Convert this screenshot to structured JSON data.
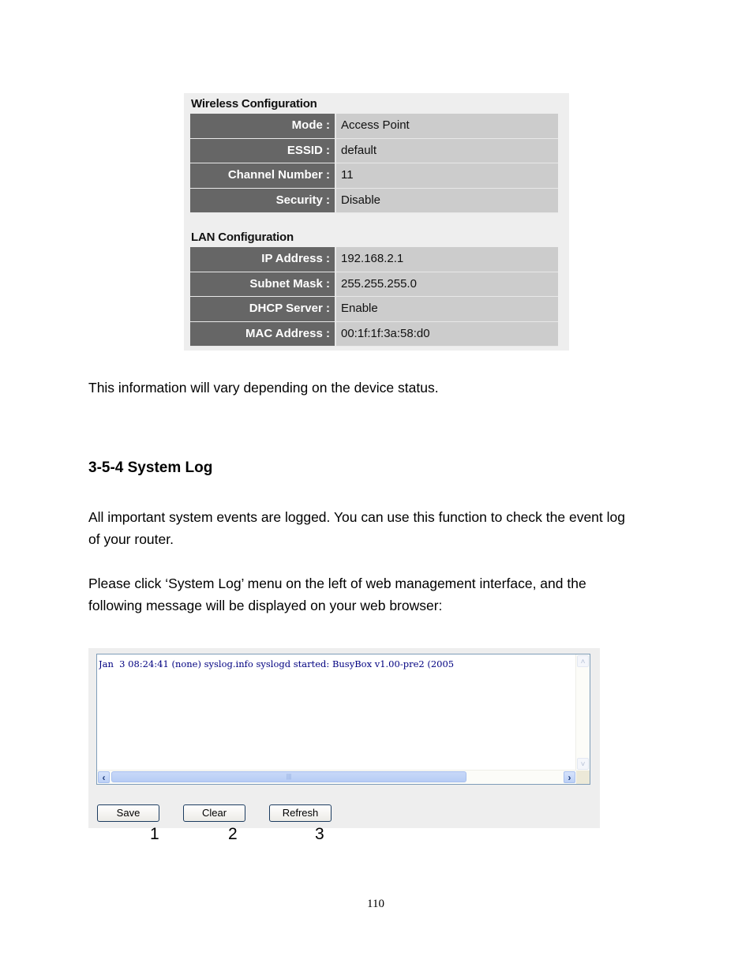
{
  "status": {
    "wireless": {
      "title": "Wireless Configuration",
      "rows": [
        {
          "label": "Mode :",
          "value": "Access Point"
        },
        {
          "label": "ESSID :",
          "value": "default"
        },
        {
          "label": "Channel Number :",
          "value": "11"
        },
        {
          "label": "Security :",
          "value": "Disable"
        }
      ]
    },
    "lan": {
      "title": "LAN Configuration",
      "rows": [
        {
          "label": "IP Address :",
          "value": "192.168.2.1"
        },
        {
          "label": "Subnet Mask :",
          "value": "255.255.255.0"
        },
        {
          "label": "DHCP Server :",
          "value": "Enable"
        },
        {
          "label": "MAC Address :",
          "value": "00:1f:1f:3a:58:d0"
        }
      ]
    }
  },
  "text": {
    "vary_note": "This information will vary depending on the device status.",
    "section_heading": "3-5-4 System Log",
    "para1_line1": "All important system events are logged. You can use this function to check the event log",
    "para1_line2": "of your router.",
    "para2_line1": "Please click ‘System Log’ menu on the left of web management interface, and the",
    "para2_line2": "following message will be displayed on your web browser:"
  },
  "syslog": {
    "log_text": "Jan  3 08:24:41 (none) syslog.info syslogd started: BusyBox v1.00-pre2 (2005",
    "scroll_up": "˄",
    "scroll_down": "˅",
    "scroll_left": "‹",
    "scroll_right": "›",
    "thumb_grip": "|||",
    "buttons": {
      "save": "Save",
      "clear": "Clear",
      "refresh": "Refresh"
    },
    "callouts": [
      "1",
      "2",
      "3"
    ]
  },
  "page_number": "110"
}
